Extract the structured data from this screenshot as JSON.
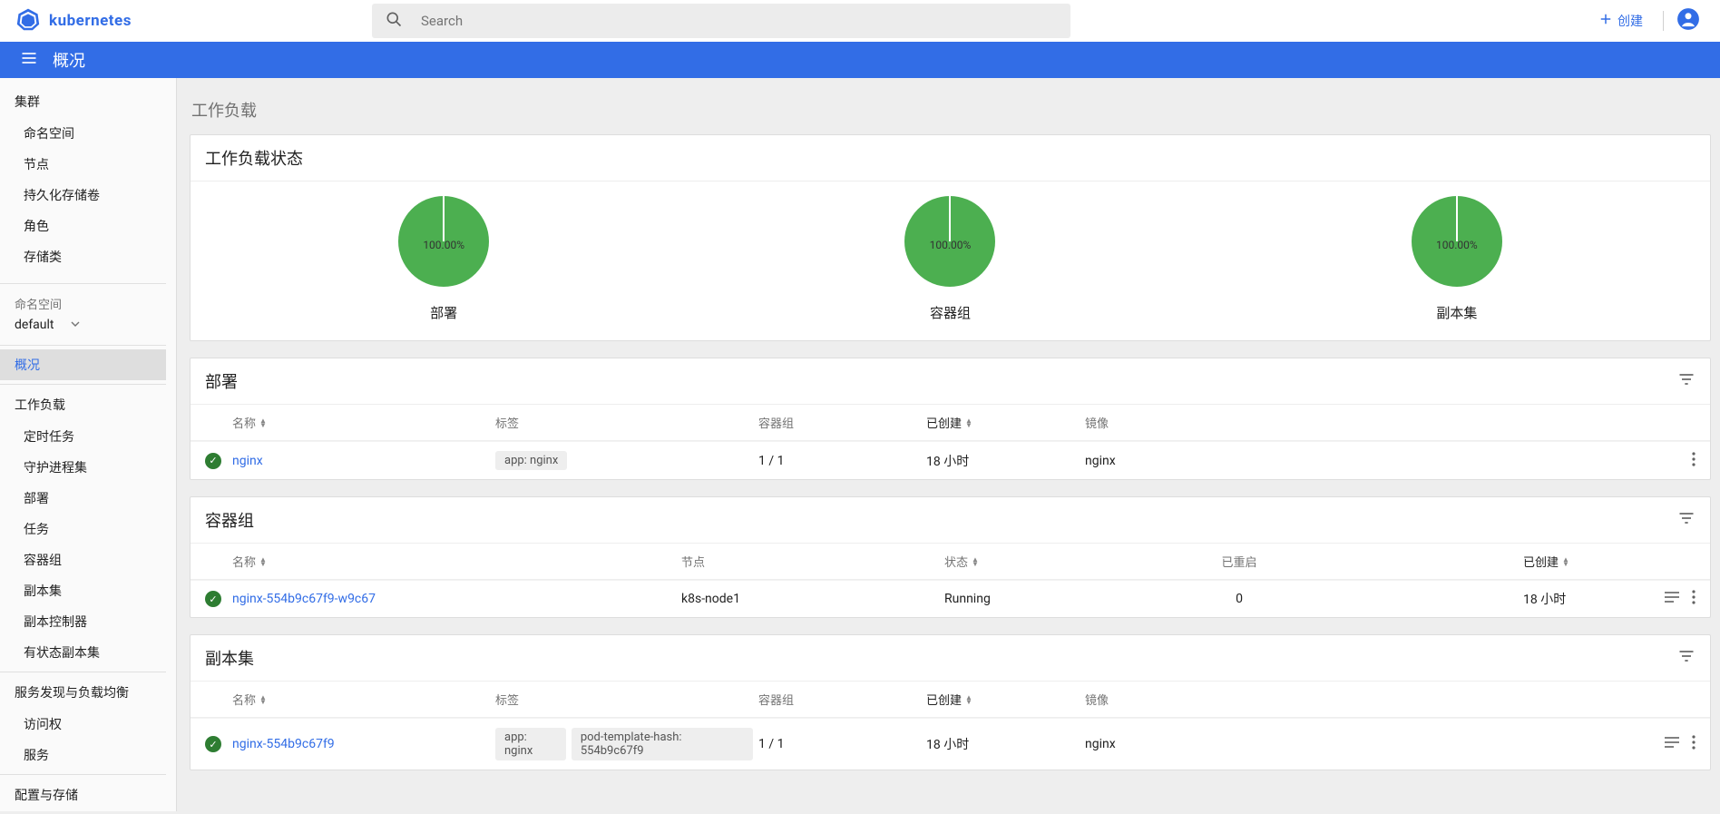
{
  "app": {
    "name": "kubernetes",
    "page_title": "概况"
  },
  "search": {
    "placeholder": "Search"
  },
  "create": {
    "label": "创建"
  },
  "sidebar": {
    "cluster": {
      "head": "集群",
      "items": [
        "命名空间",
        "节点",
        "持久化存储卷",
        "角色",
        "存储类"
      ]
    },
    "ns_label": "命名空间",
    "ns_value": "default",
    "overview": "概况",
    "workloads": {
      "head": "工作负载",
      "items": [
        "定时任务",
        "守护进程集",
        "部署",
        "任务",
        "容器组",
        "副本集",
        "副本控制器",
        "有状态副本集"
      ]
    },
    "services": {
      "head": "服务发现与负载均衡",
      "items": [
        "访问权",
        "服务"
      ]
    },
    "config": {
      "head": "配置与存储"
    }
  },
  "section_label": "工作负载",
  "status_card": {
    "title": "工作负载状态",
    "items": [
      {
        "pct": "100.00%",
        "label": "部署"
      },
      {
        "pct": "100.00%",
        "label": "容器组"
      },
      {
        "pct": "100.00%",
        "label": "副本集"
      }
    ]
  },
  "deploy": {
    "title": "部署",
    "cols": {
      "name": "名称",
      "labels": "标签",
      "pods": "容器组",
      "created": "已创建",
      "images": "镜像"
    },
    "row": {
      "name": "nginx",
      "label_chip": "app: nginx",
      "pods": "1 / 1",
      "created": "18 小时",
      "image": "nginx"
    }
  },
  "pods": {
    "title": "容器组",
    "cols": {
      "name": "名称",
      "node": "节点",
      "state": "状态",
      "restart": "已重启",
      "created": "已创建"
    },
    "row": {
      "name": "nginx-554b9c67f9-w9c67",
      "node": "k8s-node1",
      "state": "Running",
      "restart": "0",
      "created": "18 小时"
    }
  },
  "rs": {
    "title": "副本集",
    "cols": {
      "name": "名称",
      "labels": "标签",
      "pods": "容器组",
      "created": "已创建",
      "images": "镜像"
    },
    "row": {
      "name": "nginx-554b9c67f9",
      "chip1": "app: nginx",
      "chip2": "pod-template-hash: 554b9c67f9",
      "pods": "1 / 1",
      "created": "18 小时",
      "image": "nginx"
    }
  }
}
